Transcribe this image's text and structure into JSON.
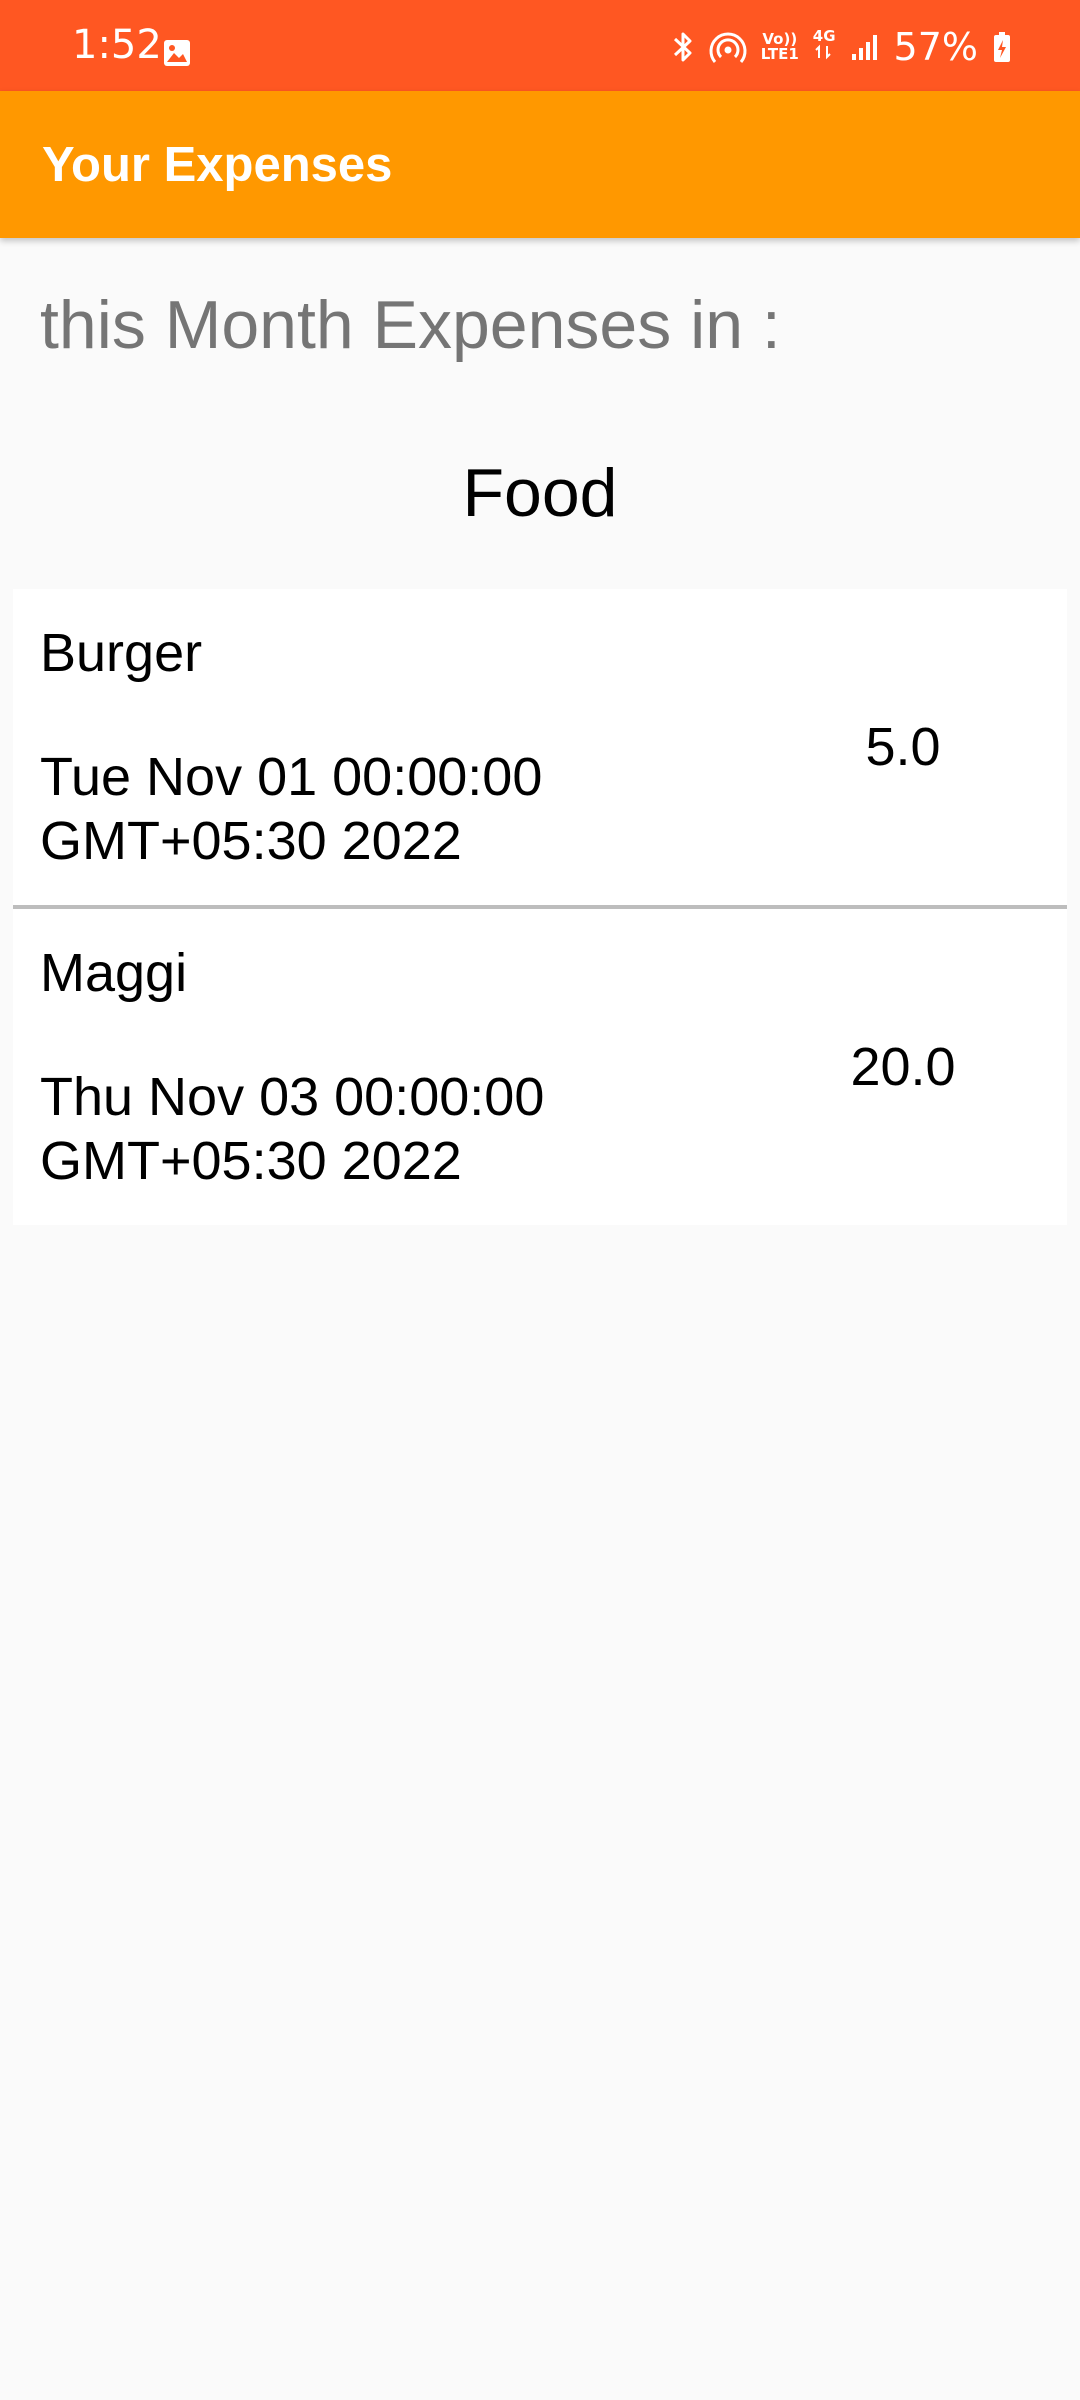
{
  "status_bar": {
    "time": "1:52",
    "volte_line1": "Vo))",
    "volte_line2": "LTE1",
    "network_type": "4G",
    "battery_percent": "57%",
    "icons": [
      "gallery-icon",
      "bluetooth-icon",
      "hotspot-icon",
      "signal-icon",
      "battery-icon"
    ]
  },
  "app_bar": {
    "title": "Your Expenses"
  },
  "main": {
    "heading": "this Month Expenses in :",
    "category": "Food",
    "expenses": [
      {
        "name": "Burger",
        "date": "Tue Nov 01 00:00:00 GMT+05:30 2022",
        "amount": "5.0"
      },
      {
        "name": "Maggi",
        "date": "Thu Nov 03 00:00:00 GMT+05:30 2022",
        "amount": "20.0"
      }
    ]
  },
  "colors": {
    "status_bar": "#ff5722",
    "app_bar": "#ff9800",
    "background": "#fafafa",
    "heading_text": "#757575",
    "divider": "#bdbdbd"
  }
}
